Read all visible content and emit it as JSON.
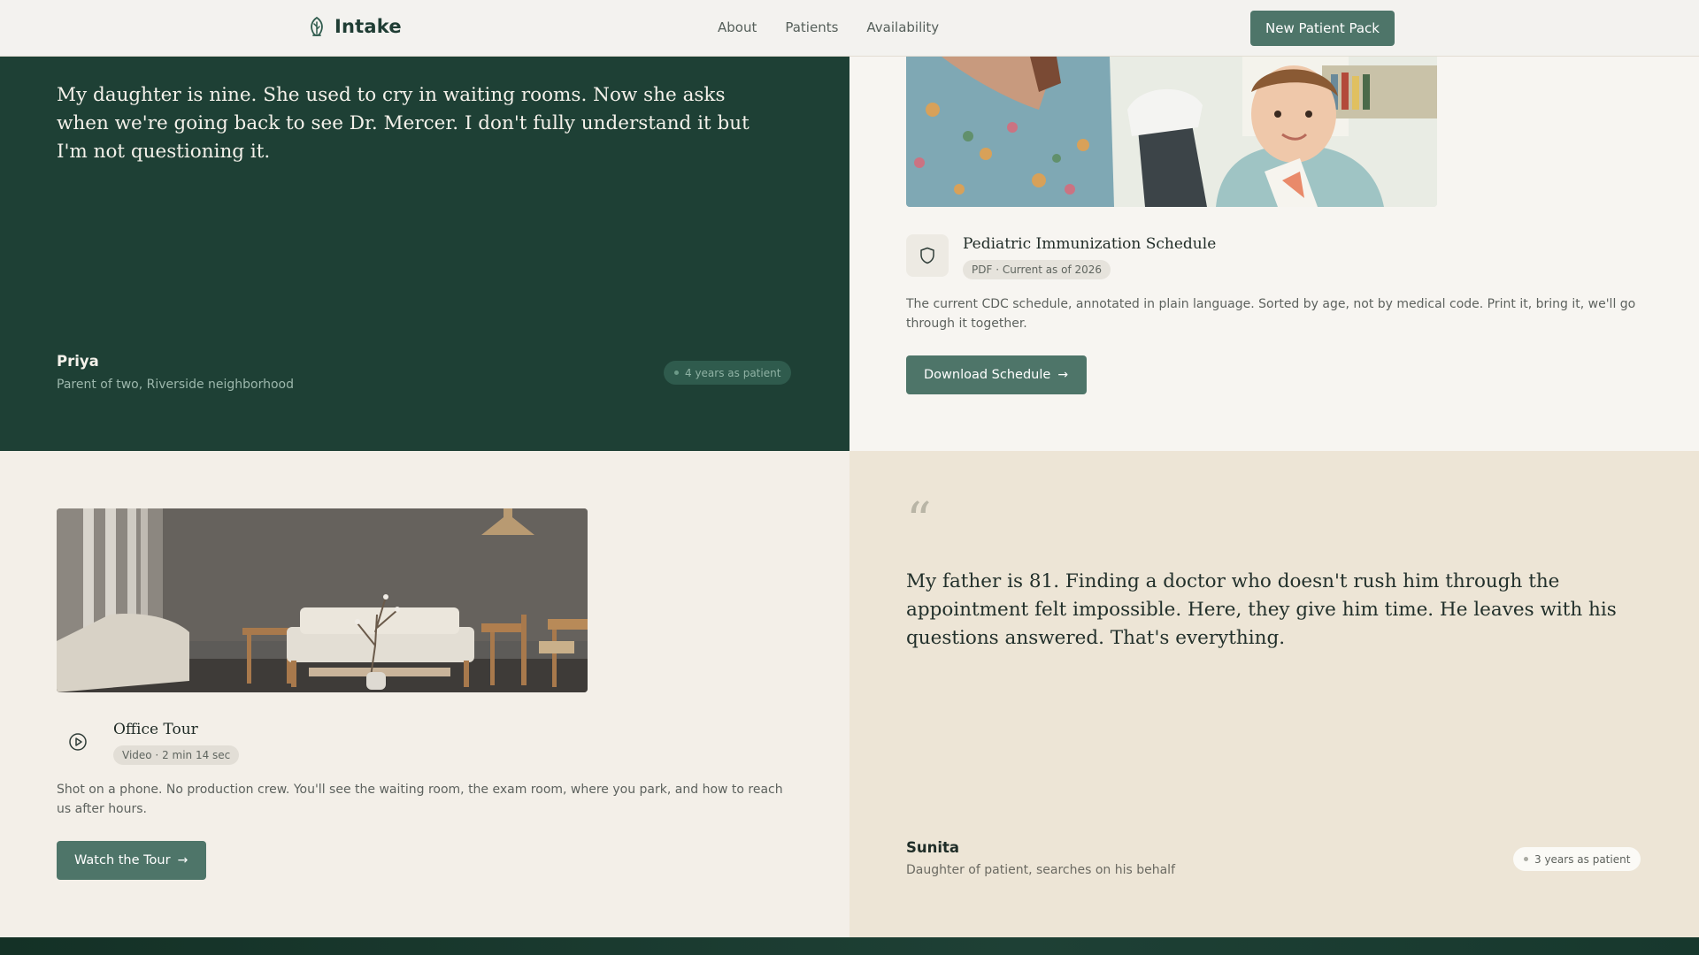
{
  "header": {
    "logo_text": "Intake",
    "nav": [
      "About",
      "Patients",
      "Availability"
    ],
    "cta_label": "New Patient Pack"
  },
  "testimonials": [
    {
      "quote": "My daughter is nine. She used to cry in waiting rooms. Now she asks when we're going back to see Dr. Mercer. I don't fully understand it but I'm not questioning it.",
      "author": "Priya",
      "role": "Parent of two, Riverside neighborhood",
      "tenure": "4 years as patient"
    },
    {
      "quote_mark": "“",
      "quote": "My father is 81. Finding a doctor who doesn't rush him through the appointment felt impossible. Here, they give him time. He leaves with his questions answered. That's everything.",
      "author": "Sunita",
      "role": "Daughter of patient, searches on his behalf",
      "tenure": "3 years as patient"
    }
  ],
  "resources": [
    {
      "icon": "shield-icon",
      "title": "Pediatric Immunization Schedule",
      "meta": "PDF · Current as of 2026",
      "description": "The current CDC schedule, annotated in plain language. Sorted by age, not by medical code. Print it, bring it, we'll go through it together.",
      "button": "Download Schedule"
    },
    {
      "icon": "play-icon",
      "title": "Office Tour",
      "meta": "Video · 2 min 14 sec",
      "description": "Shot on a phone. No production crew. You'll see the waiting room, the exam room, where you park, and how to reach us after hours.",
      "button": "Watch the Tour"
    }
  ],
  "colors": {
    "brand_dark": "#1e4035",
    "button": "#4e7569",
    "cream": "#ede5d6"
  }
}
